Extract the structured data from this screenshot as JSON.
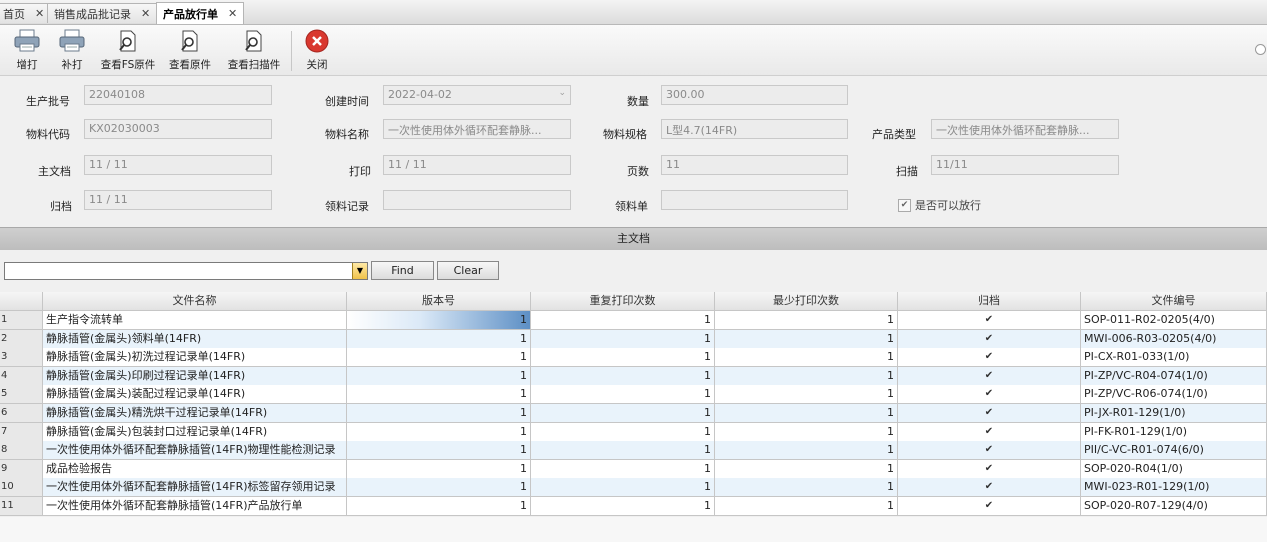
{
  "tabs": [
    {
      "label": "首页",
      "close": "✕"
    },
    {
      "label": "销售成品批记录",
      "close": "✕"
    },
    {
      "label": "产品放行单",
      "close": "✕"
    }
  ],
  "toolbar": {
    "buttons": [
      {
        "label": "增打",
        "icon": "printer-icon"
      },
      {
        "label": "补打",
        "icon": "printer-icon"
      },
      {
        "label": "查看FS原件",
        "icon": "document-search-icon"
      },
      {
        "label": "查看原件",
        "icon": "document-search-icon"
      },
      {
        "label": "查看扫描件",
        "icon": "document-search-icon"
      },
      {
        "label": "关闭",
        "icon": "close-icon"
      }
    ]
  },
  "form": {
    "batch_no": {
      "label": "生产批号",
      "value": "22040108"
    },
    "created_time": {
      "label": "创建时间",
      "value": "2022-04-02"
    },
    "quantity": {
      "label": "数量",
      "value": "300.00"
    },
    "material_code": {
      "label": "物料代码",
      "value": "KX02030003"
    },
    "material_name": {
      "label": "物料名称",
      "value": "一次性使用体外循环配套静脉..."
    },
    "material_spec": {
      "label": "物料规格",
      "value": "L型4.7(14FR)"
    },
    "product_type": {
      "label": "产品类型",
      "value": "一次性使用体外循环配套静脉..."
    },
    "main_doc": {
      "label": "主文档",
      "value": "11 / 11"
    },
    "print": {
      "label": "打印",
      "value": "11 / 11"
    },
    "pages": {
      "label": "页数",
      "value": "11"
    },
    "scan": {
      "label": "扫描",
      "value": "11/11"
    },
    "archive": {
      "label": "归档",
      "value": "11 / 11"
    },
    "pick_record": {
      "label": "领料记录",
      "value": ""
    },
    "pick_list": {
      "label": "领料单",
      "value": ""
    },
    "releasable": {
      "label": "是否可以放行",
      "checked": true
    }
  },
  "section_title": "主文档",
  "find": {
    "find_label": "Find",
    "clear_label": "Clear",
    "value": ""
  },
  "table": {
    "columns": [
      "文件名称",
      "版本号",
      "重复打印次数",
      "最少打印次数",
      "归档",
      "文件编号"
    ],
    "rows": [
      {
        "idx": "1",
        "name": "生产指令流转单",
        "ver": "1",
        "reprint": "1",
        "minprint": "1",
        "archived": true,
        "code": "SOP-011-R02-0205(4/0)"
      },
      {
        "idx": "2",
        "name": "静脉插管(金属头)领料单(14FR)",
        "ver": "1",
        "reprint": "1",
        "minprint": "1",
        "archived": true,
        "code": "MWI-006-R03-0205(4/0)"
      },
      {
        "idx": "3",
        "name": "静脉插管(金属头)初洗过程记录单(14FR)",
        "ver": "1",
        "reprint": "1",
        "minprint": "1",
        "archived": true,
        "code": "PI-CX-R01-033(1/0)"
      },
      {
        "idx": "4",
        "name": "静脉插管(金属头)印刷过程记录单(14FR)",
        "ver": "1",
        "reprint": "1",
        "minprint": "1",
        "archived": true,
        "code": "PI-ZP/VC-R04-074(1/0)"
      },
      {
        "idx": "5",
        "name": "静脉插管(金属头)装配过程记录单(14FR)",
        "ver": "1",
        "reprint": "1",
        "minprint": "1",
        "archived": true,
        "code": "PI-ZP/VC-R06-074(1/0)"
      },
      {
        "idx": "6",
        "name": "静脉插管(金属头)精洗烘干过程记录单(14FR)",
        "ver": "1",
        "reprint": "1",
        "minprint": "1",
        "archived": true,
        "code": "PI-JX-R01-129(1/0)"
      },
      {
        "idx": "7",
        "name": "静脉插管(金属头)包装封口过程记录单(14FR)",
        "ver": "1",
        "reprint": "1",
        "minprint": "1",
        "archived": true,
        "code": "PI-FK-R01-129(1/0)"
      },
      {
        "idx": "8",
        "name": "一次性使用体外循环配套静脉插管(14FR)物理性能检测记录",
        "ver": "1",
        "reprint": "1",
        "minprint": "1",
        "archived": true,
        "code": "PII/C-VC-R01-074(6/0)"
      },
      {
        "idx": "9",
        "name": "成品检验报告",
        "ver": "1",
        "reprint": "1",
        "minprint": "1",
        "archived": true,
        "code": "SOP-020-R04(1/0)"
      },
      {
        "idx": "10",
        "name": "一次性使用体外循环配套静脉插管(14FR)标签留存领用记录",
        "ver": "1",
        "reprint": "1",
        "minprint": "1",
        "archived": true,
        "code": "MWI-023-R01-129(1/0)"
      },
      {
        "idx": "11",
        "name": "一次性使用体外循环配套静脉插管(14FR)产品放行单",
        "ver": "1",
        "reprint": "1",
        "minprint": "1",
        "archived": true,
        "code": "SOP-020-R07-129(4/0)"
      }
    ]
  },
  "colors": {
    "accent": "#5d8fc5",
    "close_red": "#d9382f",
    "row_alt": "#e9f3fb"
  }
}
